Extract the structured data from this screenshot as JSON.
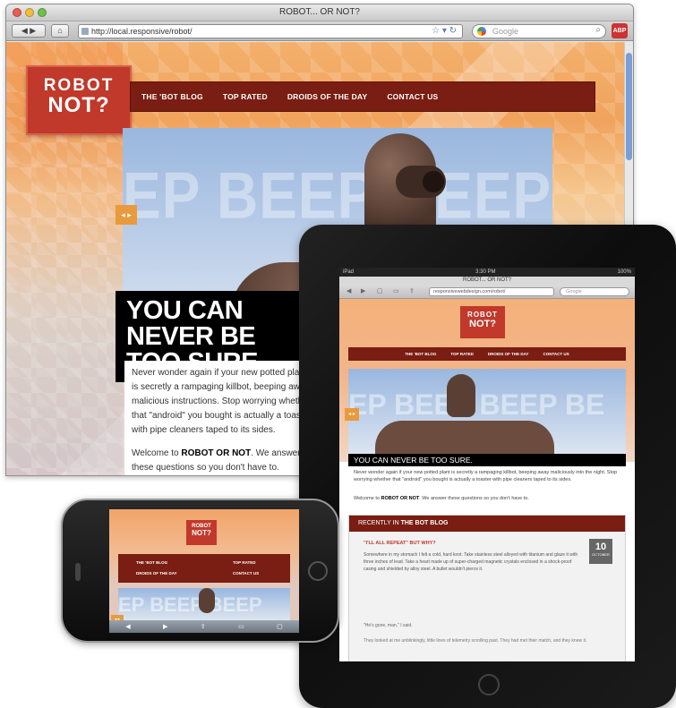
{
  "browser": {
    "window_title": "ROBOT... OR NOT?",
    "url": "http://local.responsive/robot/",
    "search_placeholder": "Google",
    "back_label": "◀ ▶",
    "home_label": "⌂",
    "addon_label": "ABP"
  },
  "site": {
    "logo_line1": "ROBOT",
    "logo_line2": "NOT?",
    "nav": [
      "THE 'BOT BLOG",
      "TOP RATED",
      "DROIDS OF THE DAY",
      "CONTACT US"
    ],
    "hero_bg_text": "EP BEEP BEEP BEEP",
    "hero_arrows": "◂ ▸",
    "headline_1": "YOU CAN NEVER BE",
    "headline_2": "TOO SURE.",
    "intro": "Never wonder again if your new potted plant is secretly a rampaging killbot, beeping away malicious instructions. Stop worrying whether that \"android\" you bought is actually a toaster with pipe cleaners taped to its sides.",
    "welcome_prefix": "Welcome to",
    "welcome_brand": "ROBOT OR NOT",
    "welcome_suffix": ". We answer these questions so you don't have to."
  },
  "ipad": {
    "status_left": "iPad",
    "status_time": "3:30 PM",
    "status_right": "100%",
    "page_title": "ROBOT... OR NOT?",
    "url": "responsivewebdesign.com/robot/",
    "search_placeholder": "Google",
    "hero_bg_text": "EP BEEP BEEP BE",
    "headline": "YOU CAN NEVER BE TOO SURE.",
    "intro": "Never wonder again if your new potted plant is secretly a rampaging killbot, beeping away maliciously into the night. Stop worrying whether that \"android\" you bought is actually a toaster with pipe cleaners taped to its sides.",
    "welcome_prefix": "Welcome to",
    "welcome_brand": "ROBOT OR NOT",
    "welcome_suffix": ". We answer these questions so you don't have to.",
    "panel_prefix": "RECENTLY IN",
    "panel_brand": "THE BOT BLOG",
    "post_title": "\"I'LL ALL REPEAT\" BUT WHY?",
    "post_excerpt": "Somewhere in my stomach I felt a cold, hard knot. Take stainless steel alloyed with titanium and glaze it with three inches of lead. Take a heart made up of super-charged magnetic crystals enclosed in a shock-proof casing and shielded by alloy steel. A bullet wouldn't pierce it.",
    "post_quote": "\"He's gone, man,\" I said.",
    "post_more": "They looked at me unblinkingly, little lines of telemetry scrolling past. They had met their match, and they knew it.",
    "date_day": "10",
    "date_month": "OCTOBER"
  },
  "iphone": {
    "nav_left": [
      "THE 'BOT BLOG",
      "DROIDS OF THE DAY"
    ],
    "nav_right": [
      "TOP RATED",
      "CONTACT US"
    ],
    "hero_bg_text": "EP BEEP BEEP",
    "toolbar": [
      "◀",
      "▶",
      "⇪",
      "▭",
      "▢"
    ]
  }
}
